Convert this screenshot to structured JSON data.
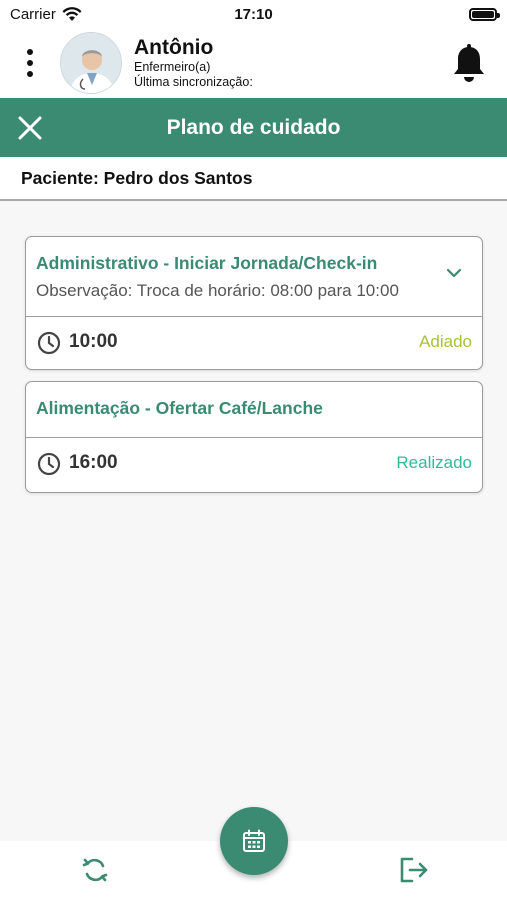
{
  "status_bar": {
    "carrier": "Carrier",
    "time": "17:10"
  },
  "header": {
    "user_name": "Antônio",
    "user_role": "Enfermeiro(a)",
    "sync_label": "Última sincronização:"
  },
  "titlebar": {
    "title": "Plano de cuidado"
  },
  "patient": {
    "label": "Paciente: Pedro dos Santos"
  },
  "cards": [
    {
      "title": "Administrativo - Iniciar Jornada/Check-in",
      "observation": "Observação: Troca de horário: 08:00 para 10:00",
      "time": "10:00",
      "status": "Adiado"
    },
    {
      "title": "Alimentação - Ofertar Café/Lanche",
      "time": "16:00",
      "status": "Realizado"
    }
  ],
  "icons": {
    "menu": "kebab-menu-icon",
    "notifications": "bell-icon",
    "close": "close-icon",
    "expand": "chevron-down-icon",
    "time": "clock-icon",
    "calendar": "calendar-icon",
    "sync": "sync-icon",
    "logout": "logout-icon"
  },
  "colors": {
    "primary": "#3b8a72",
    "adiado": "#a8c23a",
    "realizado": "#33b89a"
  }
}
